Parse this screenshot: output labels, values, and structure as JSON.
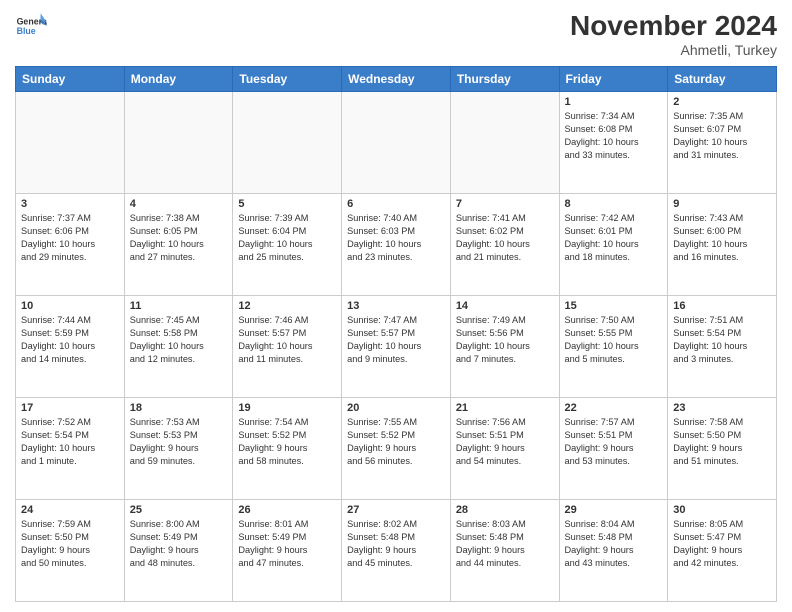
{
  "header": {
    "logo_line1": "General",
    "logo_line2": "Blue",
    "month": "November 2024",
    "location": "Ahmetli, Turkey"
  },
  "weekdays": [
    "Sunday",
    "Monday",
    "Tuesday",
    "Wednesday",
    "Thursday",
    "Friday",
    "Saturday"
  ],
  "weeks": [
    [
      {
        "day": "",
        "info": "",
        "empty": true
      },
      {
        "day": "",
        "info": "",
        "empty": true
      },
      {
        "day": "",
        "info": "",
        "empty": true
      },
      {
        "day": "",
        "info": "",
        "empty": true
      },
      {
        "day": "",
        "info": "",
        "empty": true
      },
      {
        "day": "1",
        "info": "Sunrise: 7:34 AM\nSunset: 6:08 PM\nDaylight: 10 hours\nand 33 minutes.",
        "empty": false
      },
      {
        "day": "2",
        "info": "Sunrise: 7:35 AM\nSunset: 6:07 PM\nDaylight: 10 hours\nand 31 minutes.",
        "empty": false
      }
    ],
    [
      {
        "day": "3",
        "info": "Sunrise: 7:37 AM\nSunset: 6:06 PM\nDaylight: 10 hours\nand 29 minutes.",
        "empty": false
      },
      {
        "day": "4",
        "info": "Sunrise: 7:38 AM\nSunset: 6:05 PM\nDaylight: 10 hours\nand 27 minutes.",
        "empty": false
      },
      {
        "day": "5",
        "info": "Sunrise: 7:39 AM\nSunset: 6:04 PM\nDaylight: 10 hours\nand 25 minutes.",
        "empty": false
      },
      {
        "day": "6",
        "info": "Sunrise: 7:40 AM\nSunset: 6:03 PM\nDaylight: 10 hours\nand 23 minutes.",
        "empty": false
      },
      {
        "day": "7",
        "info": "Sunrise: 7:41 AM\nSunset: 6:02 PM\nDaylight: 10 hours\nand 21 minutes.",
        "empty": false
      },
      {
        "day": "8",
        "info": "Sunrise: 7:42 AM\nSunset: 6:01 PM\nDaylight: 10 hours\nand 18 minutes.",
        "empty": false
      },
      {
        "day": "9",
        "info": "Sunrise: 7:43 AM\nSunset: 6:00 PM\nDaylight: 10 hours\nand 16 minutes.",
        "empty": false
      }
    ],
    [
      {
        "day": "10",
        "info": "Sunrise: 7:44 AM\nSunset: 5:59 PM\nDaylight: 10 hours\nand 14 minutes.",
        "empty": false
      },
      {
        "day": "11",
        "info": "Sunrise: 7:45 AM\nSunset: 5:58 PM\nDaylight: 10 hours\nand 12 minutes.",
        "empty": false
      },
      {
        "day": "12",
        "info": "Sunrise: 7:46 AM\nSunset: 5:57 PM\nDaylight: 10 hours\nand 11 minutes.",
        "empty": false
      },
      {
        "day": "13",
        "info": "Sunrise: 7:47 AM\nSunset: 5:57 PM\nDaylight: 10 hours\nand 9 minutes.",
        "empty": false
      },
      {
        "day": "14",
        "info": "Sunrise: 7:49 AM\nSunset: 5:56 PM\nDaylight: 10 hours\nand 7 minutes.",
        "empty": false
      },
      {
        "day": "15",
        "info": "Sunrise: 7:50 AM\nSunset: 5:55 PM\nDaylight: 10 hours\nand 5 minutes.",
        "empty": false
      },
      {
        "day": "16",
        "info": "Sunrise: 7:51 AM\nSunset: 5:54 PM\nDaylight: 10 hours\nand 3 minutes.",
        "empty": false
      }
    ],
    [
      {
        "day": "17",
        "info": "Sunrise: 7:52 AM\nSunset: 5:54 PM\nDaylight: 10 hours\nand 1 minute.",
        "empty": false
      },
      {
        "day": "18",
        "info": "Sunrise: 7:53 AM\nSunset: 5:53 PM\nDaylight: 9 hours\nand 59 minutes.",
        "empty": false
      },
      {
        "day": "19",
        "info": "Sunrise: 7:54 AM\nSunset: 5:52 PM\nDaylight: 9 hours\nand 58 minutes.",
        "empty": false
      },
      {
        "day": "20",
        "info": "Sunrise: 7:55 AM\nSunset: 5:52 PM\nDaylight: 9 hours\nand 56 minutes.",
        "empty": false
      },
      {
        "day": "21",
        "info": "Sunrise: 7:56 AM\nSunset: 5:51 PM\nDaylight: 9 hours\nand 54 minutes.",
        "empty": false
      },
      {
        "day": "22",
        "info": "Sunrise: 7:57 AM\nSunset: 5:51 PM\nDaylight: 9 hours\nand 53 minutes.",
        "empty": false
      },
      {
        "day": "23",
        "info": "Sunrise: 7:58 AM\nSunset: 5:50 PM\nDaylight: 9 hours\nand 51 minutes.",
        "empty": false
      }
    ],
    [
      {
        "day": "24",
        "info": "Sunrise: 7:59 AM\nSunset: 5:50 PM\nDaylight: 9 hours\nand 50 minutes.",
        "empty": false
      },
      {
        "day": "25",
        "info": "Sunrise: 8:00 AM\nSunset: 5:49 PM\nDaylight: 9 hours\nand 48 minutes.",
        "empty": false
      },
      {
        "day": "26",
        "info": "Sunrise: 8:01 AM\nSunset: 5:49 PM\nDaylight: 9 hours\nand 47 minutes.",
        "empty": false
      },
      {
        "day": "27",
        "info": "Sunrise: 8:02 AM\nSunset: 5:48 PM\nDaylight: 9 hours\nand 45 minutes.",
        "empty": false
      },
      {
        "day": "28",
        "info": "Sunrise: 8:03 AM\nSunset: 5:48 PM\nDaylight: 9 hours\nand 44 minutes.",
        "empty": false
      },
      {
        "day": "29",
        "info": "Sunrise: 8:04 AM\nSunset: 5:48 PM\nDaylight: 9 hours\nand 43 minutes.",
        "empty": false
      },
      {
        "day": "30",
        "info": "Sunrise: 8:05 AM\nSunset: 5:47 PM\nDaylight: 9 hours\nand 42 minutes.",
        "empty": false
      }
    ]
  ]
}
